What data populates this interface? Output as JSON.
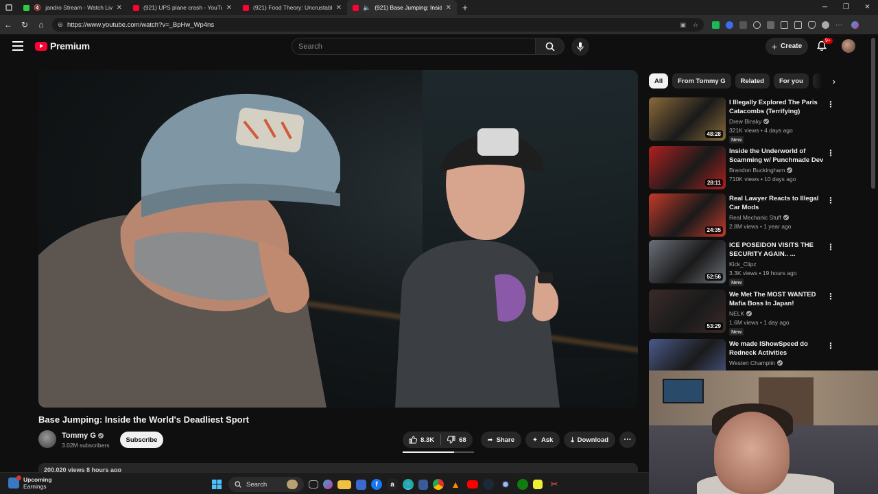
{
  "browser": {
    "tabs": [
      {
        "title": "jandro Stream - Watch Live o",
        "color": "#2ecc40",
        "muted": true
      },
      {
        "title": "(921) UPS plane crash - YouTube",
        "color": "#ff0033",
        "muted": false
      },
      {
        "title": "(921) Food Theory: Uncrustables",
        "color": "#ff0033",
        "muted": false
      },
      {
        "title": "(921) Base Jumping: Inside th",
        "color": "#ff0033",
        "muted": true
      }
    ],
    "url": "https://www.youtube.com/watch?v=_BpHw_Wp4ns"
  },
  "header": {
    "logo_text": "Premium",
    "search_placeholder": "Search",
    "create_label": "Create",
    "notifications_badge": "9+"
  },
  "video": {
    "title": "Base Jumping: Inside the World's Deadliest Sport",
    "channel": "Tommy G",
    "subscribers": "3.02M subscribers",
    "subscribe_label": "Subscribe",
    "likes": "8.3K",
    "dislikes": "68",
    "like_ratio": 0.72,
    "share_label": "Share",
    "ask_label": "Ask",
    "download_label": "Download",
    "views_peek": "200,020 views  8 hours ago"
  },
  "chips": [
    "All",
    "From Tommy G",
    "Related",
    "For you"
  ],
  "recommendations": [
    {
      "title": "I Illegally Explored The Paris Catacombs (Terrifying)",
      "channel": "Drew Binsky",
      "verified": true,
      "meta": "321K views • 4 days ago",
      "badge": "New",
      "duration": "48:28",
      "thumb_color": "#8a6a3a"
    },
    {
      "title": "Inside the Underworld of Scamming w/ Punchmade Dev",
      "channel": "Brandon Buckingham",
      "verified": true,
      "meta": "710K views • 10 days ago",
      "badge": "",
      "duration": "28:11",
      "thumb_color": "#b02020"
    },
    {
      "title": "Real Lawyer Reacts to Illegal Car Mods",
      "channel": "Real Mechanic Stuff",
      "verified": true,
      "meta": "2.8M views • 1 year ago",
      "badge": "",
      "duration": "24:35",
      "thumb_color": "#c23a2a"
    },
    {
      "title": "ICE POSEIDON VISITS THE SECURITY AGAIN.. ...",
      "channel": "Kick_Clipz",
      "verified": false,
      "meta": "3.3K views • 19 hours ago",
      "badge": "New",
      "duration": "52:56",
      "thumb_color": "#6a6f78"
    },
    {
      "title": "We Met The MOST WANTED Mafia Boss In Japan!",
      "channel": "NELK",
      "verified": true,
      "meta": "1.6M views • 1 day ago",
      "badge": "New",
      "duration": "53:29",
      "thumb_color": "#3a2a2a"
    },
    {
      "title": "We made IShowSpeed do Redneck Activities",
      "channel": "Westen Champlin",
      "verified": true,
      "meta": "",
      "badge": "",
      "duration": "",
      "thumb_color": "#4a5a8a"
    }
  ],
  "taskbar": {
    "weather_line1": "Upcoming",
    "weather_line2": "Earnings",
    "search_label": "Search"
  }
}
